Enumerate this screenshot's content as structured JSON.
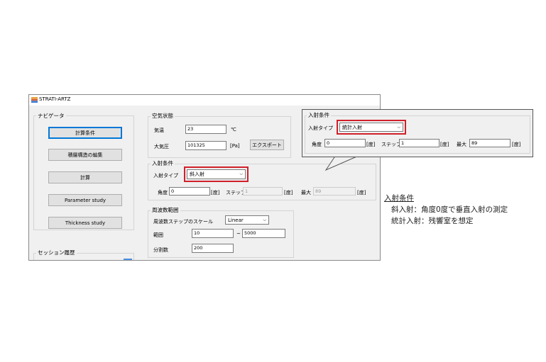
{
  "window": {
    "title": "STRATI-ARTZ"
  },
  "navigator": {
    "label": "ナビゲータ",
    "buttons": [
      "計算条件",
      "積層構造の編集",
      "計算",
      "Parameter study",
      "Thickness study"
    ]
  },
  "session": {
    "label": "セッション履歴"
  },
  "air": {
    "label": "空気状態",
    "temp_label": "気温",
    "temp_value": "23",
    "temp_unit": "℃",
    "pressure_label": "大気圧",
    "pressure_value": "101325",
    "pressure_unit": "[Pa]",
    "export_label": "エクスポート"
  },
  "incidence": {
    "label": "入射条件",
    "type_label": "入射タイプ",
    "type_value": "斜入射",
    "angle_label": "角度",
    "angle_value": "0",
    "angle_unit": "[度]",
    "step_label": "ステップ",
    "step_value": "1",
    "step_unit": "[度]",
    "max_label": "最大",
    "max_value": "89",
    "max_unit": "[度]"
  },
  "frequency": {
    "label": "周波数範囲",
    "scale_label": "周波数ステップのスケール",
    "scale_value": "Linear",
    "range_label": "範囲",
    "range_from": "10",
    "range_sep": "~",
    "range_to": "5000",
    "div_label": "分割数",
    "div_value": "200"
  },
  "callout": {
    "label": "入射条件",
    "type_label": "入射タイプ",
    "type_value": "統計入射",
    "angle_label": "角度",
    "angle_value": "0",
    "angle_unit": "[度]",
    "step_label": "ステップ",
    "step_value": "1",
    "step_unit": "[度]",
    "max_label": "最大",
    "max_value": "89",
    "max_unit": "[度]"
  },
  "note": {
    "title": "入射条件",
    "line1": "斜入射：角度0度で垂直入射の測定",
    "line2": "統計入射：残響室を想定"
  },
  "colors": {
    "highlight": "#d0202a",
    "accent": "#0078d7",
    "window_bg": "#f0f0f0"
  }
}
